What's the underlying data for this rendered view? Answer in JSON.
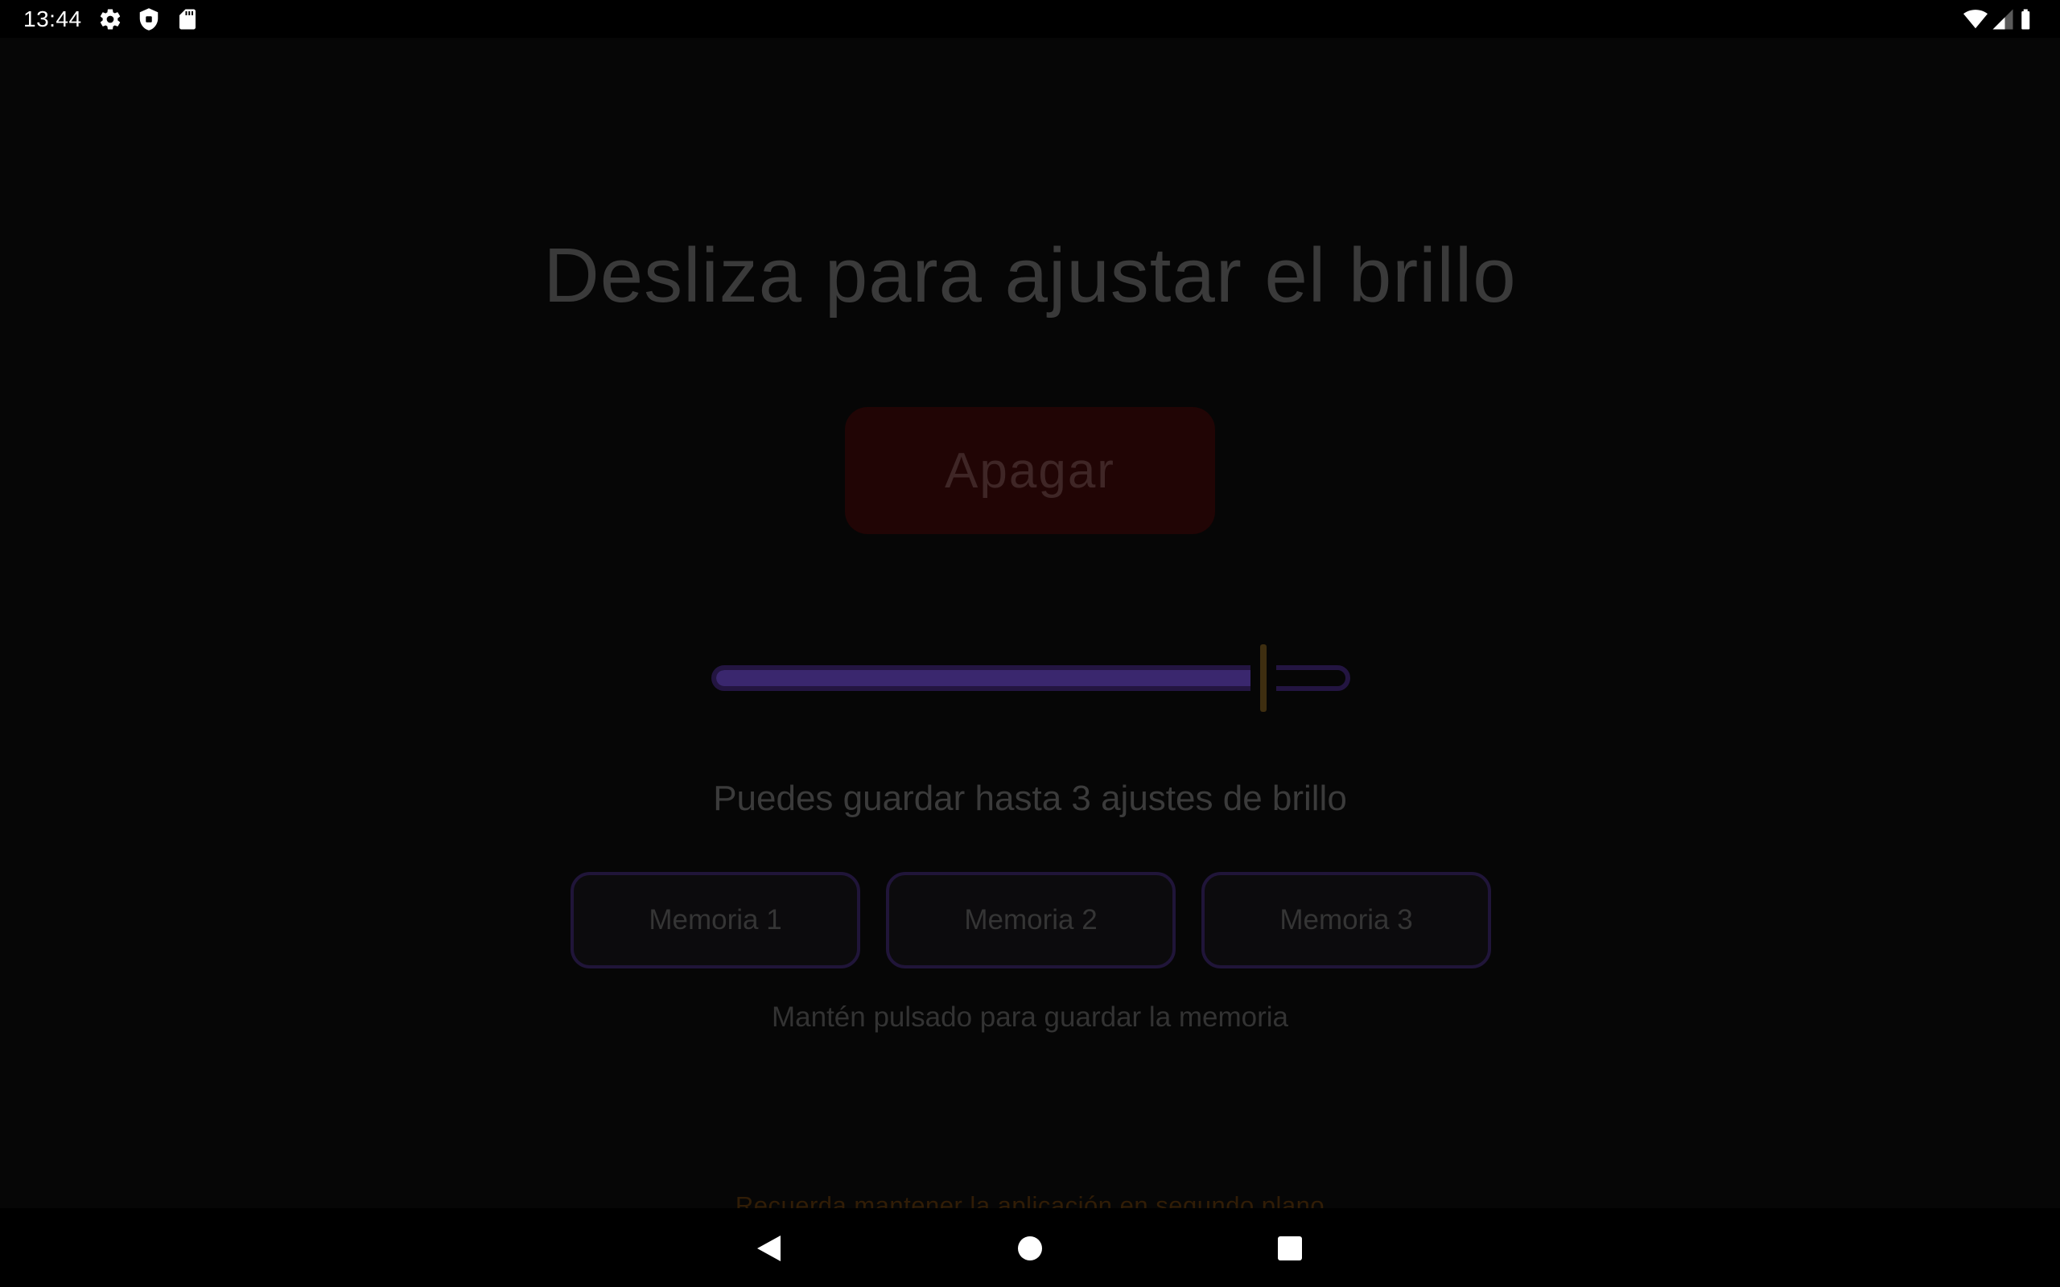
{
  "status_bar": {
    "time": "13:44",
    "icons": [
      "gear-icon",
      "shield-icon",
      "sd-card-icon",
      "wifi-icon",
      "signal-icon",
      "battery-icon"
    ]
  },
  "main": {
    "title": "Desliza para ajustar el brillo",
    "off_button_label": "Apagar",
    "brightness_level": 0.87,
    "subtitle": "Puedes guardar hasta 3 ajustes de brillo",
    "memory_buttons": [
      {
        "label": "Memoria 1"
      },
      {
        "label": "Memoria 2"
      },
      {
        "label": "Memoria 3"
      }
    ],
    "hint": "Mantén pulsado para guardar la memoria",
    "footer_note": "Recuerda mantener la aplicación en segundo plano"
  },
  "nav_bar": {
    "icons": [
      "back-icon",
      "home-icon",
      "recents-icon"
    ]
  },
  "colors": {
    "background": "#060606",
    "off_button": "#210505",
    "slider_accent": "#3a276e",
    "slider_thumb": "#3e2e10",
    "memory_border": "#201539",
    "footer_note": "#311d06"
  }
}
